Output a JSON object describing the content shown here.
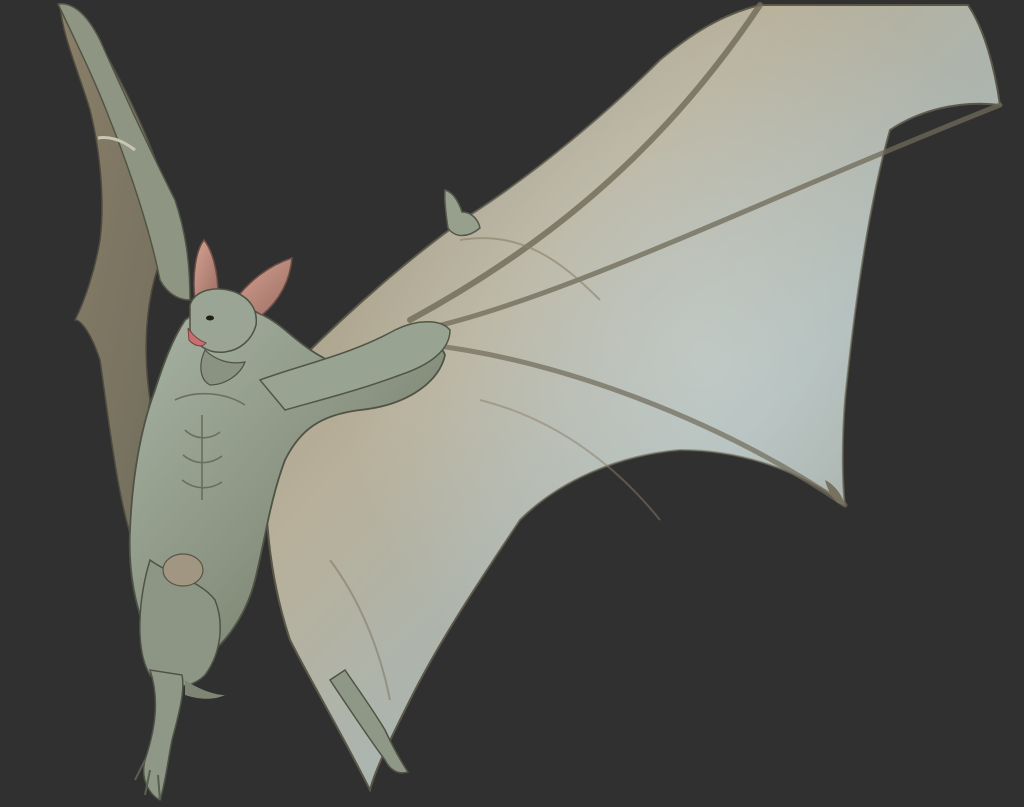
{
  "scene": {
    "subject_icon": "bat-creature-icon",
    "colors": {
      "background": "#303030",
      "skin_light": "#a7b3a4",
      "skin_mid": "#8c9583",
      "skin_dark": "#5f6452",
      "membrane_warm": "#b3a08b",
      "membrane_cool": "#b9c7c6",
      "ear_inner": "#c98f82",
      "mouth": "#c86e70"
    }
  }
}
